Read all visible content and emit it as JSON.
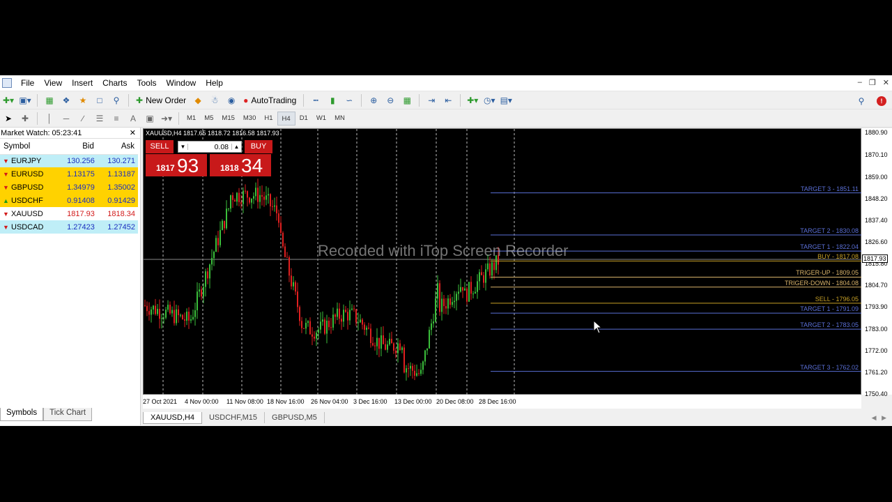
{
  "menu": [
    "File",
    "View",
    "Insert",
    "Charts",
    "Tools",
    "Window",
    "Help"
  ],
  "toolbar": {
    "new_order": "New Order",
    "autotrading": "AutoTrading"
  },
  "timeframes": [
    "M1",
    "M5",
    "M15",
    "M30",
    "H1",
    "H4",
    "D1",
    "W1",
    "MN"
  ],
  "active_timeframe": "H4",
  "market_watch": {
    "title": "Market Watch: 05:23:41",
    "columns": [
      "Symbol",
      "Bid",
      "Ask"
    ],
    "rows": [
      {
        "symbol": "EURJPY",
        "bid": "130.256",
        "ask": "130.271",
        "bg": "cyan",
        "dir": "down"
      },
      {
        "symbol": "EURUSD",
        "bid": "1.13175",
        "ask": "1.13187",
        "bg": "yellow",
        "dir": "down"
      },
      {
        "symbol": "GBPUSD",
        "bid": "1.34979",
        "ask": "1.35002",
        "bg": "yellow",
        "dir": "down"
      },
      {
        "symbol": "USDCHF",
        "bid": "0.91408",
        "ask": "0.91429",
        "bg": "yellow",
        "dir": "up"
      },
      {
        "symbol": "XAUUSD",
        "bid": "1817.93",
        "ask": "1818.34",
        "bg": "white",
        "dir": "down"
      },
      {
        "symbol": "USDCAD",
        "bid": "1.27423",
        "ask": "1.27452",
        "bg": "cyan",
        "dir": "down"
      }
    ],
    "tabs": [
      "Symbols",
      "Tick Chart"
    ]
  },
  "chart": {
    "info": "XAUUSD,H4  1817.65 1818.72 1816.58 1817.93",
    "sell_label": "SELL",
    "buy_label": "BUY",
    "lot": "0.08",
    "sell_price_small": "1817",
    "sell_price_big": "93",
    "buy_price_small": "1818",
    "buy_price_big": "34",
    "watermark": "Recorded with iTop Screen Recorder",
    "current_price": "1817.93",
    "y_ticks": [
      "1880.90",
      "1870.10",
      "1859.00",
      "1848.20",
      "1837.40",
      "1826.60",
      "1815.80",
      "1804.70",
      "1793.90",
      "1783.00",
      "1772.00",
      "1761.20",
      "1750.40"
    ],
    "x_ticks": [
      "27 Oct 2021",
      "4 Nov 00:00",
      "11 Nov 08:00",
      "18 Nov 16:00",
      "26 Nov 04:00",
      "3 Dec 16:00",
      "13 Dec 00:00",
      "20 Dec 08:00",
      "28 Dec 16:00"
    ],
    "levels": [
      {
        "text": "TARGET 3 - 1851.11",
        "price": 1851.11,
        "color": "#5a6fd6"
      },
      {
        "text": "TARGET 2 - 1830.08",
        "price": 1830.08,
        "color": "#5a6fd6"
      },
      {
        "text": "TARGET 1 - 1822.04",
        "price": 1822.04,
        "color": "#5a6fd6"
      },
      {
        "text": "BUY - 1817.08",
        "price": 1817.08,
        "color": "#c9a227"
      },
      {
        "text": "TRIGER-UP      - 1809.05",
        "price": 1809.05,
        "color": "#d9b36a"
      },
      {
        "text": "TRIGER-DOWN - 1804.08",
        "price": 1804.08,
        "color": "#d9b36a"
      },
      {
        "text": "SELL - 1796.05",
        "price": 1796.05,
        "color": "#c9a227"
      },
      {
        "text": "TARGET 1 - 1791.09",
        "price": 1791.09,
        "color": "#5a6fd6"
      },
      {
        "text": "TARGET 2 - 1783.05",
        "price": 1783.05,
        "color": "#5a6fd6"
      },
      {
        "text": "TARGET 3 - 1762.02",
        "price": 1762.02,
        "color": "#5a6fd6"
      }
    ],
    "tabs": [
      "XAUUSD,H4",
      "USDCHF,M15",
      "GBPUSD,M5"
    ]
  }
}
